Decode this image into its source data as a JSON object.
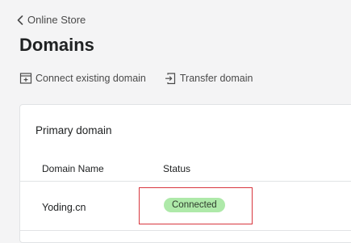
{
  "breadcrumb": {
    "label": "Online Store"
  },
  "page": {
    "title": "Domains"
  },
  "actions": {
    "connect_label": "Connect existing domain",
    "transfer_label": "Transfer domain"
  },
  "primary_domain": {
    "title": "Primary domain",
    "columns": {
      "name": "Domain Name",
      "status": "Status"
    },
    "rows": [
      {
        "name": "Yoding.cn",
        "status": "Connected"
      }
    ]
  },
  "colors": {
    "status_connected_bg": "#aee9a9",
    "highlight_border": "#d8363e"
  }
}
